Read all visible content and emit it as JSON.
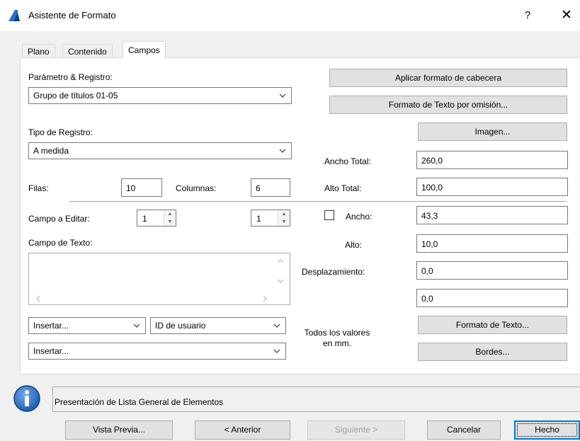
{
  "window": {
    "title": "Asistente de Formato",
    "help_label": "?",
    "close_label": "✕"
  },
  "tabs": [
    {
      "label": "Plano",
      "active": false
    },
    {
      "label": "Contenido",
      "active": false
    },
    {
      "label": "Campos",
      "active": true
    }
  ],
  "left": {
    "parametro_label": "Parámetro & Registro:",
    "parametro_value": "Grupo de títulos 01-05",
    "tipo_label": "Tipo de Registro:",
    "tipo_value": "A medida",
    "filas_label": "Filas:",
    "filas_value": "10",
    "columnas_label": "Columnas:",
    "columnas_value": "6",
    "campo_editar_label": "Campo a Editar:",
    "campo_editar_value_1": "1",
    "campo_editar_value_2": "1",
    "campo_texto_label": "Campo de Texto:",
    "campo_texto_value": "",
    "insertar_1": "Insertar...",
    "id_usuario": "ID de usuario",
    "insertar_2": "Insertar..."
  },
  "right": {
    "aplicar_cabecera": "Aplicar formato de cabecera",
    "formato_omision": "Formato de Texto por omisión...",
    "imagen": "Imagen...",
    "ancho_total_label": "Ancho Total:",
    "ancho_total_value": "260,0",
    "alto_total_label": "Alto Total:",
    "alto_total_value": "100,0",
    "ancho_label": "Ancho:",
    "ancho_value": "43,3",
    "ancho_checked": false,
    "alto_label": "Alto:",
    "alto_value": "10,0",
    "desplazamiento_label": "Desplazamiento:",
    "desplazamiento_x": "0,0",
    "desplazamiento_y": "0,0",
    "todos_valores_line1": "Todos los valores",
    "todos_valores_line2": "en mm.",
    "formato_texto": "Formato de Texto...",
    "bordes": "Bordes..."
  },
  "status": {
    "message": "Presentación de Lista General de Elementos"
  },
  "footer": {
    "vista_previa": "Vista Previa...",
    "anterior": "< Anterior",
    "siguiente": "Siguiente >",
    "cancelar": "Cancelar",
    "hecho": "Hecho"
  },
  "colors": {
    "accent": "#0078d7",
    "info_icon": "#1c5fb3",
    "window_bg": "#f0f0f0"
  }
}
